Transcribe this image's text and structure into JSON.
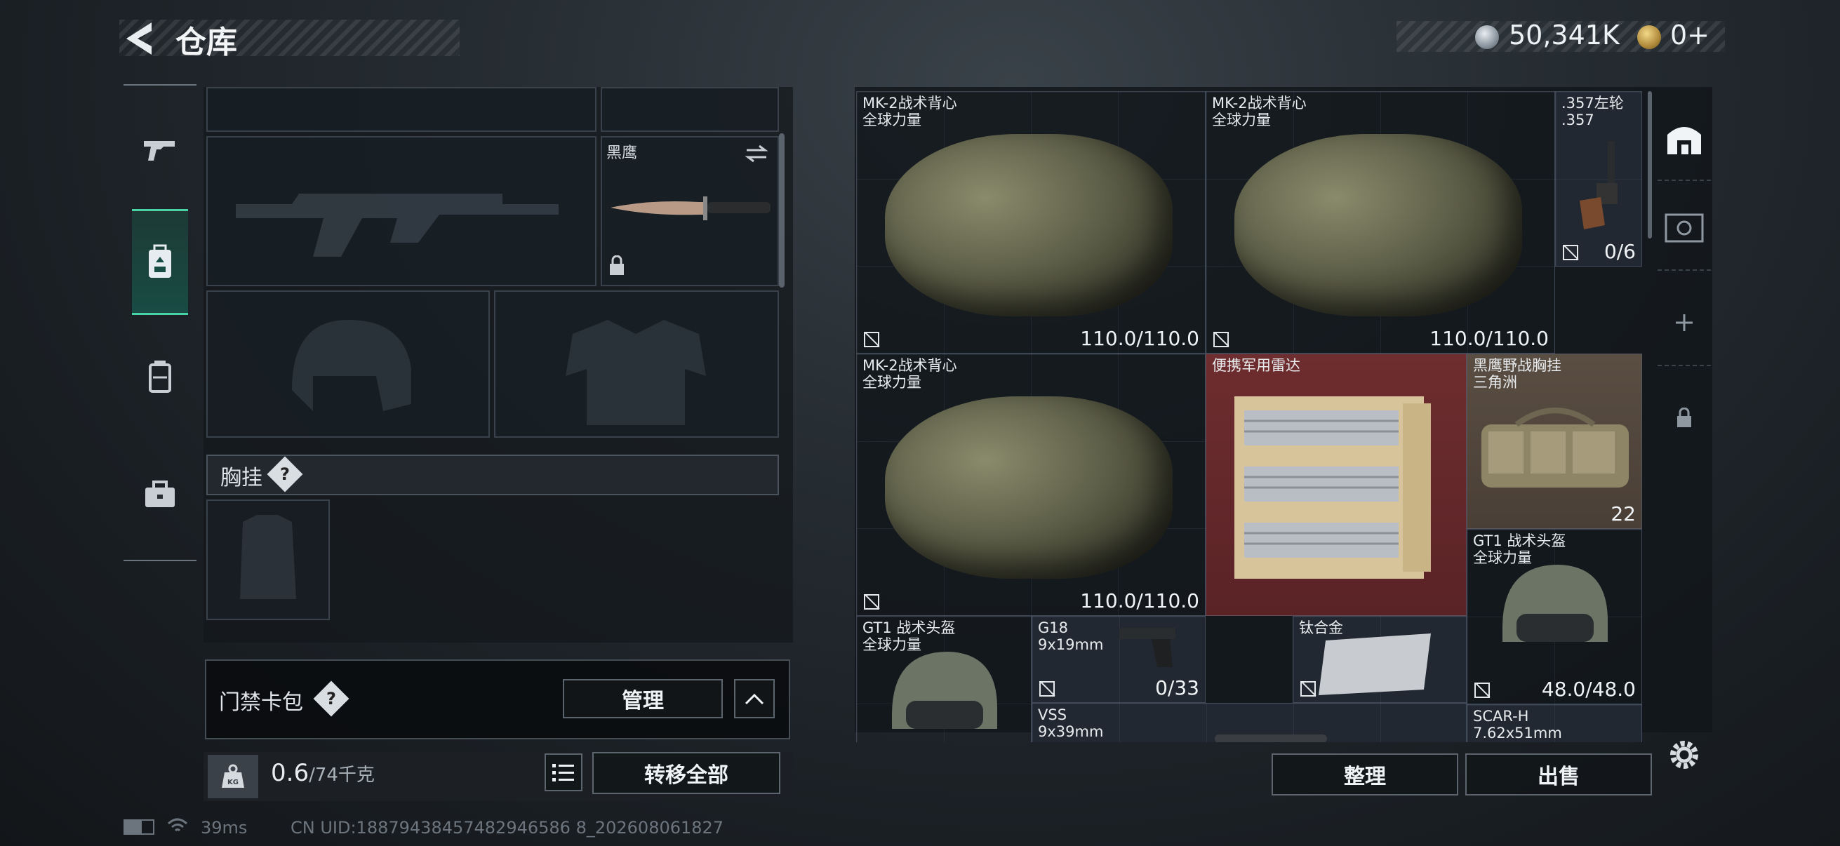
{
  "header": {
    "title": "仓库",
    "currency1": "50,341K",
    "currency2": "0+"
  },
  "left_nav": {
    "items": [
      "weapons",
      "backpack",
      "case",
      "toolbox"
    ]
  },
  "loadout": {
    "knife_label": "黑鹰",
    "chest_label": "胸挂",
    "chest_help": "?",
    "keycard_label": "门禁卡包",
    "keycard_help": "?",
    "manage_button": "管理",
    "weight_value": "0.6",
    "weight_max": "/74千克",
    "weight_icon": "KG",
    "transfer_all_button": "转移全部"
  },
  "storage": {
    "items": [
      {
        "name": "MK-2战术背心",
        "sub": "全球力量",
        "value": "110.0/110.0"
      },
      {
        "name": "MK-2战术背心",
        "sub": "全球力量",
        "value": "110.0/110.0"
      },
      {
        "name": ".357左轮",
        "sub": ".357",
        "value": "0/6"
      },
      {
        "name": "MK-2战术背心",
        "sub": "全球力量",
        "value": "110.0/110.0"
      },
      {
        "name": "便携军用雷达",
        "sub": "",
        "value": ""
      },
      {
        "name": "黑鹰野战胸挂",
        "sub": "三角洲",
        "value": "22"
      },
      {
        "name": "GT1 战术头盔",
        "sub": "全球力量",
        "value": "48.0/48.0"
      },
      {
        "name": "GT1 战术头盔",
        "sub": "全球力量",
        "value": ""
      },
      {
        "name": "G18",
        "sub": "9x19mm",
        "value": "0/33"
      },
      {
        "name": "钛合金",
        "sub": "",
        "value": ""
      },
      {
        "name": "VSS",
        "sub": "9x39mm",
        "value": ""
      },
      {
        "name": "SCAR-H",
        "sub": "7.62x51mm",
        "value": ""
      }
    ],
    "sort_button": "整理",
    "sell_button": "出售"
  },
  "footer": {
    "ping": "39ms",
    "uid": "CN UID:18879438457482946586 8_202608061827"
  },
  "colors": {
    "accent": "#48d3a6",
    "red_item": "#6e2d2f",
    "blue_item": "#2d3044",
    "tan_item": "#5a4e43"
  }
}
